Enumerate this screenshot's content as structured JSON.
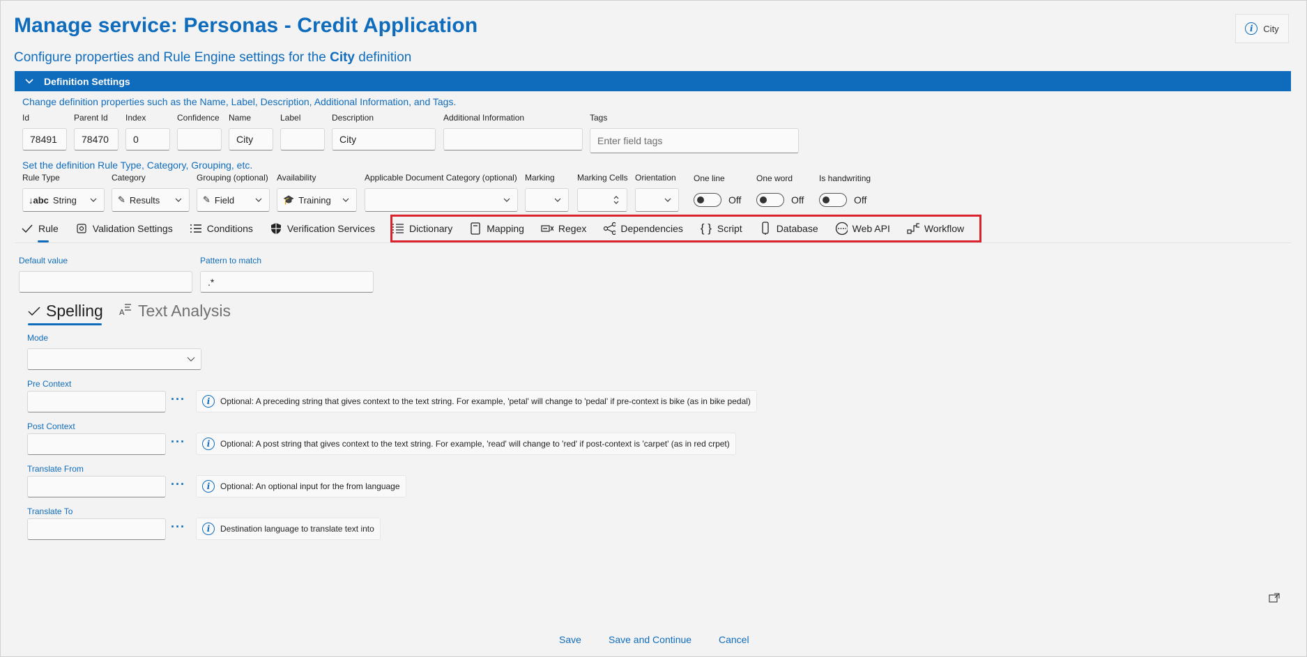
{
  "header": {
    "title": "Manage service:  Personas - Credit Application",
    "subtitle_prefix": "Configure properties and Rule Engine settings for the",
    "subtitle_entity": "City",
    "subtitle_suffix": "definition",
    "badge_label": "City"
  },
  "definition_settings": {
    "section_title": "Definition Settings",
    "properties_desc": "Change definition properties such as the Name, Label, Description, Additional Information, and Tags.",
    "fields": {
      "id": {
        "label": "Id",
        "value": "78491"
      },
      "parent_id": {
        "label": "Parent Id",
        "value": "78470"
      },
      "index": {
        "label": "Index",
        "value": "0"
      },
      "confidence": {
        "label": "Confidence",
        "value": ""
      },
      "name": {
        "label": "Name",
        "value": "City"
      },
      "label": {
        "label": "Label",
        "value": ""
      },
      "description": {
        "label": "Description",
        "value": "City"
      },
      "additional_info": {
        "label": "Additional Information",
        "value": ""
      },
      "tags": {
        "label": "Tags",
        "placeholder": "Enter field tags"
      }
    },
    "rule_desc": "Set the definition Rule Type, Category, Grouping, etc.",
    "rule_fields": {
      "rule_type": {
        "label": "Rule Type",
        "value": "String",
        "icon": "abc-text-icon"
      },
      "category": {
        "label": "Category",
        "value": "Results",
        "icon": "pencil-icon"
      },
      "grouping": {
        "label": "Grouping (optional)",
        "value": "Field",
        "icon": "pencil-icon"
      },
      "availability": {
        "label": "Availability",
        "value": "Training",
        "icon": "training-icon"
      },
      "doc_category": {
        "label": "Applicable Document Category (optional)",
        "value": ""
      },
      "marking": {
        "label": "Marking",
        "value": ""
      },
      "marking_cells": {
        "label": "Marking Cells",
        "value": ""
      },
      "orientation": {
        "label": "Orientation",
        "value": ""
      }
    },
    "toggles": [
      {
        "label": "One line",
        "state": "Off"
      },
      {
        "label": "One word",
        "state": "Off"
      },
      {
        "label": "Is handwriting",
        "state": "Off"
      }
    ]
  },
  "tabs": [
    {
      "label": "Rule",
      "icon": "checkmark-icon",
      "active": true
    },
    {
      "label": "Validation Settings",
      "icon": "validation-icon"
    },
    {
      "label": "Conditions",
      "icon": "conditions-list-icon"
    },
    {
      "label": "Verification Services",
      "icon": "shield-icon"
    },
    {
      "label": "Dictionary",
      "icon": "list-icon"
    },
    {
      "label": "Mapping",
      "icon": "book-icon"
    },
    {
      "label": "Regex",
      "icon": "regex-icon"
    },
    {
      "label": "Dependencies",
      "icon": "share-nodes-icon"
    },
    {
      "label": "Script",
      "icon": "braces-icon"
    },
    {
      "label": "Database",
      "icon": "database-icon"
    },
    {
      "label": "Web API",
      "icon": "web-api-icon"
    },
    {
      "label": "Workflow",
      "icon": "workflow-icon"
    }
  ],
  "rule_panel": {
    "default_value": {
      "label": "Default value",
      "value": ""
    },
    "pattern": {
      "label": "Pattern to match",
      "value": ".*"
    },
    "sub_tabs": [
      {
        "label": "Spelling",
        "icon": "checkmark-icon",
        "active": true
      },
      {
        "label": "Text Analysis",
        "icon": "text-analysis-icon"
      }
    ],
    "mode": {
      "label": "Mode",
      "value": ""
    },
    "context_fields": [
      {
        "label": "Pre Context",
        "value": "",
        "hint": "Optional: A preceding string that gives context to the text string. For example, 'petal' will change to 'pedal' if pre-context is bike (as in bike pedal)"
      },
      {
        "label": "Post Context",
        "value": "",
        "hint": "Optional: A post string that gives context to the text string. For example, 'read' will change to 'red' if post-context is 'carpet' (as in red crpet)"
      },
      {
        "label": "Translate From",
        "value": "",
        "hint": "Optional: An optional input for the from language"
      },
      {
        "label": "Translate To",
        "value": "",
        "hint": "Destination language to translate text into"
      }
    ]
  },
  "footer": {
    "save": "Save",
    "save_continue": "Save and Continue",
    "cancel": "Cancel"
  },
  "colors": {
    "accent": "#0f6cbd",
    "highlight": "#d9232d",
    "background": "#f3f3f3"
  }
}
